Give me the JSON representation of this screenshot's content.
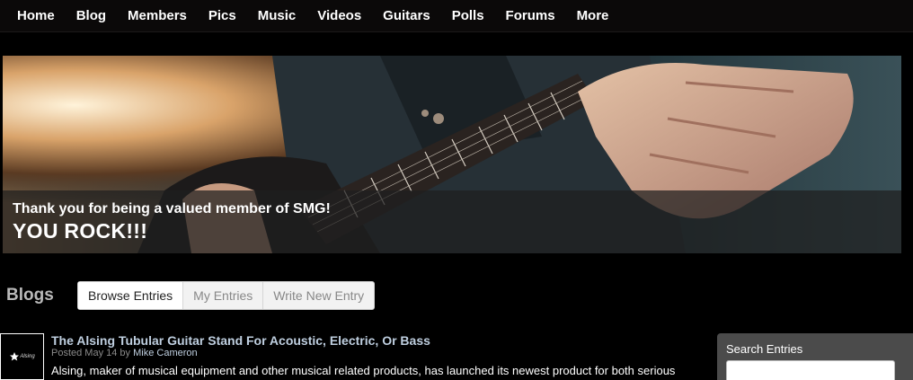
{
  "nav": {
    "items": [
      "Home",
      "Blog",
      "Members",
      "Pics",
      "Music",
      "Videos",
      "Guitars",
      "Polls",
      "Forums",
      "More"
    ]
  },
  "banner": {
    "line1": "Thank you for being a valued member of SMG!",
    "line2": "YOU ROCK!!!"
  },
  "blogs": {
    "heading": "Blogs",
    "tabs": [
      "Browse Entries",
      "My Entries",
      "Write New Entry"
    ],
    "active_tab": "Browse Entries"
  },
  "entry": {
    "thumb_label": "Alsing",
    "title": "The Alsing Tubular Guitar Stand For Acoustic, Electric, Or Bass",
    "posted_prefix": "Posted May 14 by",
    "author": "Mike Cameron",
    "excerpt": "Alsing, maker of musical equipment and other musical related products, has launched its newest product for both serious"
  },
  "search": {
    "label": "Search Entries",
    "value": ""
  }
}
